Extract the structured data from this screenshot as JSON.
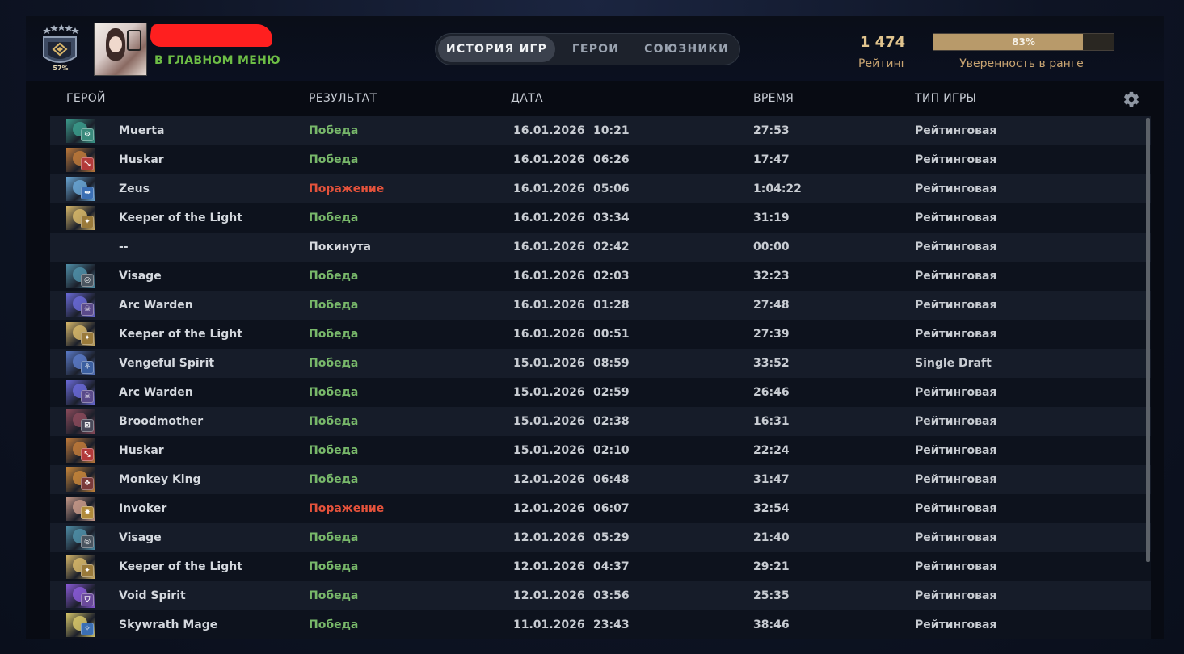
{
  "profile": {
    "rank_confidence_badge": "57%",
    "status": "В ГЛАВНОМ МЕНЮ"
  },
  "tabs": [
    {
      "label": "ИСТОРИЯ ИГР",
      "active": true
    },
    {
      "label": "ГЕРОИ",
      "active": false
    },
    {
      "label": "СОЮЗНИКИ",
      "active": false
    }
  ],
  "rating": {
    "value": "1 474",
    "label": "Рейтинг",
    "confidence_text": "83%",
    "confidence_fraction": 0.83,
    "confidence_label": "Уверенность в ранге"
  },
  "columns": {
    "hero": "ГЕРОЙ",
    "result": "РЕЗУЛЬТАТ",
    "date": "ДАТА",
    "duration": "ВРЕМЯ",
    "game_type": "ТИП ИГРЫ"
  },
  "colors": {
    "win": "#78b86a",
    "loss": "#e4523b",
    "abandon": "#ea6d33",
    "accent_gold": "#e1c48e",
    "status_green": "#6dbd45"
  },
  "matches": [
    {
      "hero": "Muerta",
      "result": "Победа",
      "outcome": "win",
      "date": "16.01.2026",
      "time": "10:21",
      "duration": "27:53",
      "type": "Рейтинговая",
      "portrait_color": "#3b9c8c",
      "role_color": "#3a8a7c"
    },
    {
      "hero": "Huskar",
      "result": "Победа",
      "outcome": "win",
      "date": "16.01.2026",
      "time": "06:26",
      "duration": "17:47",
      "type": "Рейтинговая",
      "portrait_color": "#c07a3a",
      "role_color": "#b33a3a"
    },
    {
      "hero": "Zeus",
      "result": "Поражение",
      "outcome": "loss",
      "date": "16.01.2026",
      "time": "05:06",
      "duration": "1:04:22",
      "type": "Рейтинговая",
      "portrait_color": "#6aa7d6",
      "role_color": "#3b6fb3"
    },
    {
      "hero": "Keeper of the Light",
      "result": "Победа",
      "outcome": "win",
      "date": "16.01.2026",
      "time": "03:34",
      "duration": "31:19",
      "type": "Рейтинговая",
      "portrait_color": "#d8b86a",
      "role_color": "#9a7a3a"
    },
    {
      "hero": "--",
      "result": "Покинута",
      "outcome": "abandon",
      "date": "16.01.2026",
      "time": "02:42",
      "duration": "00:00",
      "type": "Рейтинговая",
      "portrait_color": "",
      "role_color": ""
    },
    {
      "hero": "Visage",
      "result": "Победа",
      "outcome": "win",
      "date": "16.01.2026",
      "time": "02:03",
      "duration": "32:23",
      "type": "Рейтинговая",
      "portrait_color": "#4f8fa8",
      "role_color": "#4a5560"
    },
    {
      "hero": "Arc Warden",
      "result": "Победа",
      "outcome": "win",
      "date": "16.01.2026",
      "time": "01:28",
      "duration": "27:48",
      "type": "Рейтинговая",
      "portrait_color": "#6a6ad8",
      "role_color": "#5a4a8a"
    },
    {
      "hero": "Keeper of the Light",
      "result": "Победа",
      "outcome": "win",
      "date": "16.01.2026",
      "time": "00:51",
      "duration": "27:39",
      "type": "Рейтинговая",
      "portrait_color": "#d8b86a",
      "role_color": "#9a7a3a"
    },
    {
      "hero": "Vengeful Spirit",
      "result": "Победа",
      "outcome": "win",
      "date": "15.01.2026",
      "time": "08:59",
      "duration": "33:52",
      "type": "Single Draft",
      "portrait_color": "#5a7ac8",
      "role_color": "#3b5fa0"
    },
    {
      "hero": "Arc Warden",
      "result": "Победа",
      "outcome": "win",
      "date": "15.01.2026",
      "time": "02:59",
      "duration": "26:46",
      "type": "Рейтинговая",
      "portrait_color": "#6a6ad8",
      "role_color": "#5a4a8a"
    },
    {
      "hero": "Broodmother",
      "result": "Победа",
      "outcome": "win",
      "date": "15.01.2026",
      "time": "02:38",
      "duration": "16:31",
      "type": "Рейтинговая",
      "portrait_color": "#8a4a5a",
      "role_color": "#4a4a5a"
    },
    {
      "hero": "Huskar",
      "result": "Победа",
      "outcome": "win",
      "date": "15.01.2026",
      "time": "02:10",
      "duration": "22:24",
      "type": "Рейтинговая",
      "portrait_color": "#c07a3a",
      "role_color": "#b33a3a"
    },
    {
      "hero": "Monkey King",
      "result": "Победа",
      "outcome": "win",
      "date": "12.01.2026",
      "time": "06:48",
      "duration": "31:47",
      "type": "Рейтинговая",
      "portrait_color": "#c8863a",
      "role_color": "#7a3a3a"
    },
    {
      "hero": "Invoker",
      "result": "Поражение",
      "outcome": "loss",
      "date": "12.01.2026",
      "time": "06:07",
      "duration": "32:54",
      "type": "Рейтинговая",
      "portrait_color": "#c89a8a",
      "role_color": "#b08a3a"
    },
    {
      "hero": "Visage",
      "result": "Победа",
      "outcome": "win",
      "date": "12.01.2026",
      "time": "05:29",
      "duration": "21:40",
      "type": "Рейтинговая",
      "portrait_color": "#4f8fa8",
      "role_color": "#4a5560"
    },
    {
      "hero": "Keeper of the Light",
      "result": "Победа",
      "outcome": "win",
      "date": "12.01.2026",
      "time": "04:37",
      "duration": "29:21",
      "type": "Рейтинговая",
      "portrait_color": "#d8b86a",
      "role_color": "#9a7a3a"
    },
    {
      "hero": "Void Spirit",
      "result": "Победа",
      "outcome": "win",
      "date": "12.01.2026",
      "time": "03:56",
      "duration": "25:35",
      "type": "Рейтинговая",
      "portrait_color": "#8a5ad8",
      "role_color": "#6a4a9a"
    },
    {
      "hero": "Skywrath Mage",
      "result": "Победа",
      "outcome": "win",
      "date": "11.01.2026",
      "time": "23:43",
      "duration": "38:46",
      "type": "Рейтинговая",
      "portrait_color": "#d8c86a",
      "role_color": "#3b6fb3"
    }
  ]
}
